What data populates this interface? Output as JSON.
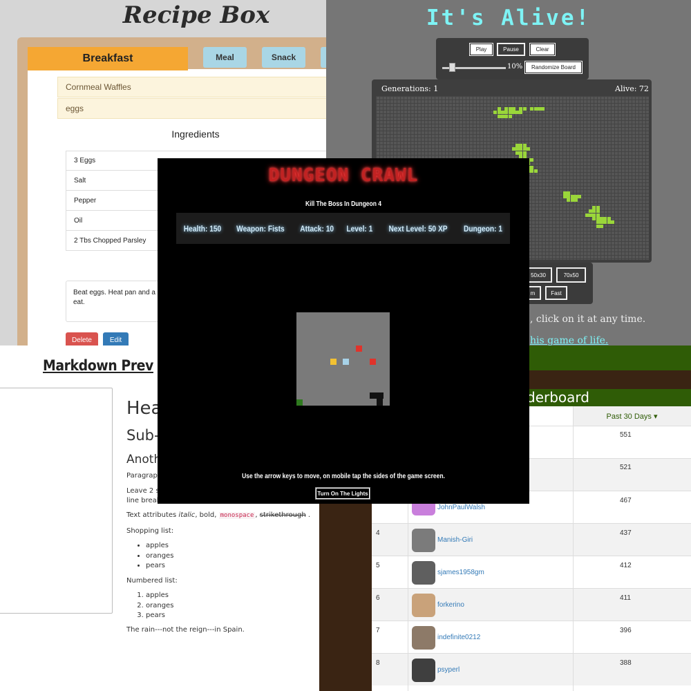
{
  "recipe_box": {
    "title": "Recipe Box",
    "tabs": [
      "Breakfast",
      "Meal",
      "Snack"
    ],
    "recipes": [
      "Cornmeal Waffles",
      "eggs"
    ],
    "ingredients_title": "Ingredients",
    "ingredients": [
      "3 Eggs",
      "Salt",
      "Pepper",
      "Oil",
      "2 Tbs Chopped Parsley"
    ],
    "directions": "Beat eggs. Heat pan and a",
    "directions_tail": "eat.",
    "delete_label": "Delete",
    "edit_label": "Edit"
  },
  "game_of_life": {
    "title": "It's Alive!",
    "play_label": "Play",
    "pause_label": "Pause",
    "clear_label": "Clear",
    "speed_pct": "10%",
    "randomize_label": "Randomize Board",
    "generations_text": "Generations: 1",
    "alive_text": "Alive: 72",
    "size_50": "50x30",
    "size_70": "70x50",
    "speed_medium": "m",
    "speed_fast": "Fast",
    "text_line1": ", click on it at any time.",
    "text_line2": "his game of life."
  },
  "markdown": {
    "title": "Markdown Prev",
    "h1": "Hea",
    "h2": "Sub-",
    "h3": "Anoth",
    "para1": "Paragrap",
    "para2a": "Leave 2 s",
    "para2b": "line break",
    "attr_prefix": "Text attributes ",
    "attr_italic": "italic",
    "attr_sep1": ", ",
    "attr_bold": "bold",
    "attr_sep2": ", ",
    "attr_mono": "monospace",
    "attr_sep3": ", ",
    "attr_strike": "strikethrough",
    "attr_end": " .",
    "shopping_label": "Shopping list:",
    "shopping": [
      "apples",
      "oranges",
      "pears"
    ],
    "numbered_label": "Numbered list:",
    "numbered": [
      "apples",
      "oranges",
      "pears"
    ],
    "rain": "The rain---not the reign---in Spain."
  },
  "leaderboard": {
    "title": "derboard",
    "col_header": "Past 30 Days ▾",
    "rows": [
      {
        "rank": "",
        "user": "",
        "score": "551"
      },
      {
        "rank": "",
        "user": "",
        "score": "521"
      },
      {
        "rank": "",
        "user": "JohnPaulWalsh",
        "score": "467"
      },
      {
        "rank": "4",
        "user": "Manish-Giri",
        "score": "437"
      },
      {
        "rank": "5",
        "user": "sjames1958gm",
        "score": "412"
      },
      {
        "rank": "6",
        "user": "forkerino",
        "score": "411"
      },
      {
        "rank": "7",
        "user": "indefinite0212",
        "score": "396"
      },
      {
        "rank": "8",
        "user": "psyperl",
        "score": "388"
      }
    ]
  },
  "dungeon": {
    "title": "DUNGEON CRAWL",
    "subtitle": "Kill The Boss In Dungeon 4",
    "stats": [
      "Health: 150",
      "Weapon: Fists",
      "Attack: 10",
      "Level: 1",
      "Next Level: 50 XP",
      "Dungeon: 1"
    ],
    "help": "Use the arrow keys to move, on mobile tap the sides of the game screen.",
    "lights_label": "Turn On The Lights"
  }
}
